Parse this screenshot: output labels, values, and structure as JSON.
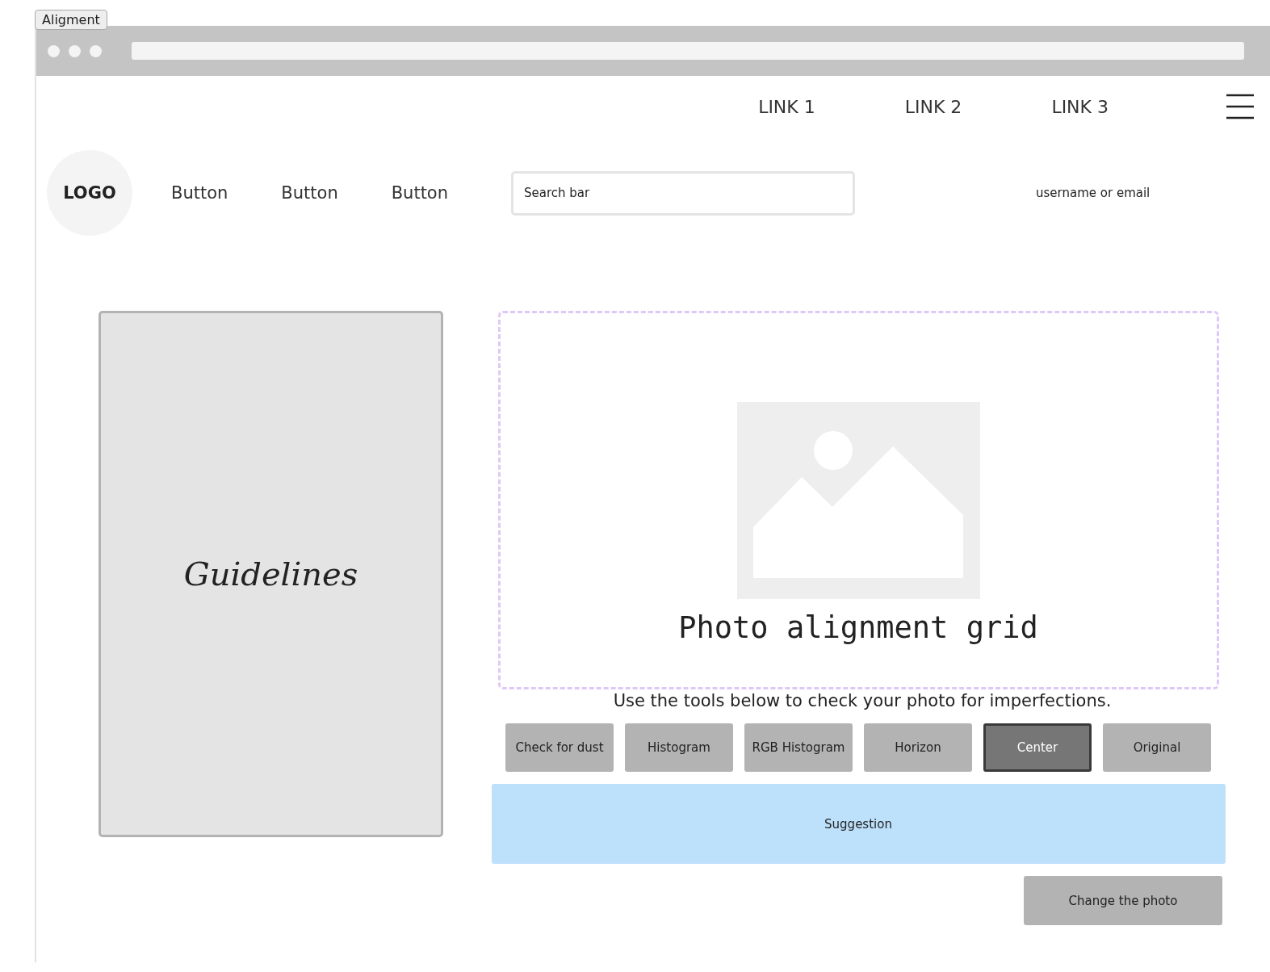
{
  "tag": "Aligment",
  "nav_links": [
    "LINK 1",
    "LINK 2",
    "LINK 3"
  ],
  "logo": "LOGO",
  "header_buttons": [
    "Button",
    "Button",
    "Button"
  ],
  "search": {
    "placeholder": "Search bar"
  },
  "user_label": "username or email",
  "guidelines": "Guidelines",
  "photo_area": {
    "title": "Photo alignment grid"
  },
  "instruction": "Use the tools below to check your photo for imperfections.",
  "tools": [
    {
      "label": "Check for dust",
      "selected": false
    },
    {
      "label": "Histogram",
      "selected": false
    },
    {
      "label": "RGB Histogram",
      "selected": false
    },
    {
      "label": "Horizon",
      "selected": false
    },
    {
      "label": "Center",
      "selected": true
    },
    {
      "label": "Original",
      "selected": false
    }
  ],
  "suggestion": "Suggestion",
  "change_button": "Change the photo"
}
